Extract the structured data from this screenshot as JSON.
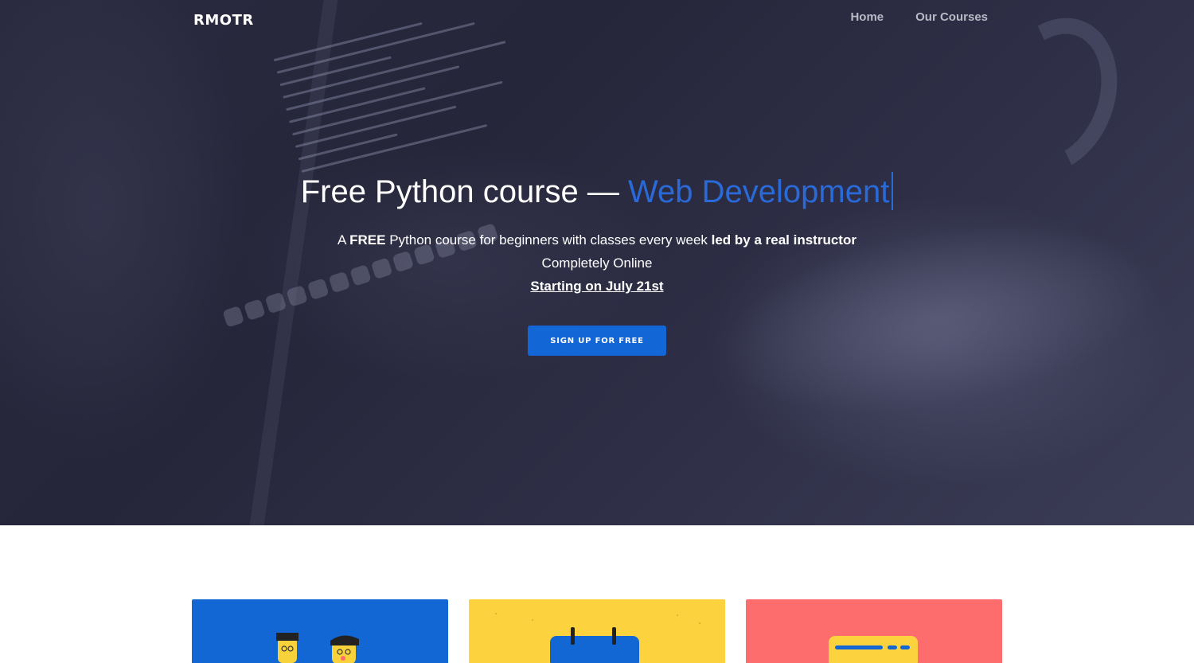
{
  "nav": {
    "logo": "RMOTR",
    "links": [
      {
        "label": "Home"
      },
      {
        "label": "Our Courses"
      }
    ]
  },
  "hero": {
    "headline_main": "Free Python course — ",
    "headline_accent": "Web Development",
    "sub1_a": "A ",
    "sub1_b": "FREE",
    "sub1_c": " Python course for beginners with classes every week ",
    "sub1_d": "led by a real instructor",
    "sub2": "Completely Online",
    "sub3": "Starting on July 21st",
    "cta_label": "SIGN UP FOR FREE"
  },
  "colors": {
    "accent": "#2a6ad8",
    "button": "#1266d6",
    "card_blue": "#1367d4",
    "card_yellow": "#fdd23f",
    "card_red": "#fe6d6d"
  }
}
